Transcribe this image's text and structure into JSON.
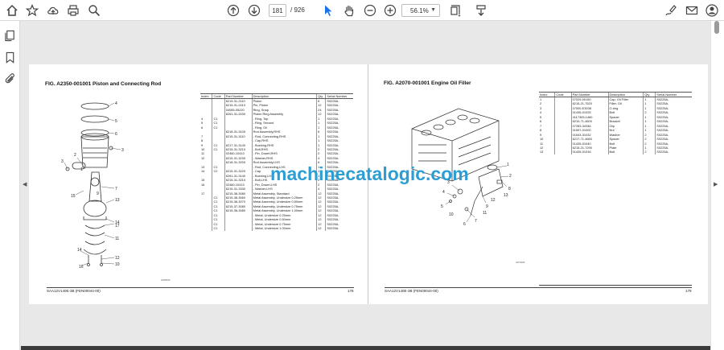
{
  "toolbar": {
    "current_page": "181",
    "total_pages": "/ 926",
    "zoom": "56.1%"
  },
  "left_page": {
    "figure_title": "FIG. A2350-001001    Piston and Connecting Rod",
    "columns": [
      "Index",
      "Code",
      "Part Number",
      "Description",
      "Qty",
      "Serial Number"
    ],
    "rows": [
      [
        "",
        "",
        "6219-31-2110",
        "Piston",
        "6",
        "S0225A-"
      ],
      [
        "",
        "",
        "6215-31-2410",
        "Pin, Piston",
        "12",
        "S0225A-"
      ],
      [
        "",
        "",
        "04065-05220",
        "Ring, Snap",
        "24",
        "S0225A-"
      ],
      [
        "",
        "",
        "6261-31-2030",
        "Piston Ring Assembly",
        "12",
        "S0225A-"
      ],
      [
        "4",
        "C1",
        "",
        "- Ring, Top",
        "1",
        "S0225A-"
      ],
      [
        "5",
        "C1",
        "",
        "- Ring, Second",
        "1",
        "S0225A-"
      ],
      [
        "6",
        "C1",
        "",
        "- Ring, Oil",
        "1",
        "S0225A-"
      ],
      [
        "",
        "",
        "6218-31-3100",
        "Rod Assembly,RHS",
        "6",
        "S0225A-"
      ],
      [
        "7",
        "",
        "6215-31-3110",
        "- Rod, Connecting,RHS",
        "1",
        "S0225A-"
      ],
      [
        "8",
        "",
        "",
        "- Cap,RHS",
        "1",
        "S0225A-"
      ],
      [
        "9",
        "C1",
        "6217-31-3140",
        "- Bushing,RHS",
        "1",
        "S0225A-"
      ],
      [
        "10",
        "C1",
        "6215-31-3210",
        "- Bolt,RHS",
        "2",
        "S0225A-"
      ],
      [
        "11",
        "",
        "02460-10413",
        "- Pin, Dowel,RHS",
        "2",
        "S0225A-"
      ],
      [
        "12",
        "",
        "6215-31-3230",
        "- Washer,RHS",
        "4",
        "S0225A-"
      ],
      [
        "",
        "",
        "6218-31-3200",
        "Rod Assembly,LHS",
        "6",
        "S0225A-"
      ],
      [
        "13",
        "C1",
        "",
        "- Rod, Connecting,LHS",
        "1",
        "S0225A-"
      ],
      [
        "14",
        "C2",
        "6215-31-3220",
        "- Cap",
        "1",
        "S0225A-"
      ],
      [
        "",
        "",
        "6261-31-3140",
        "- Bushing,LHS",
        "1",
        "S0225A-"
      ],
      [
        "15",
        "",
        "6215-31-3210",
        "- Bolt,LHS",
        "2",
        "S0225A-"
      ],
      [
        "16",
        "",
        "02460-10413",
        "- Pin, Dowel,LHS",
        "2",
        "S0225A-"
      ],
      [
        "",
        "",
        "6215-31-3330",
        "- Washer,LHS",
        "4",
        "S0225A-"
      ],
      [
        "17",
        "",
        "6215-36-3080",
        "Metal Assembly, Standard",
        "12",
        "S0225A-"
      ],
      [
        "",
        "C1",
        "6215-36-3060",
        "Metal Assembly, Undersize 0.25mm",
        "12",
        "S0225A-"
      ],
      [
        "",
        "C1",
        "6215-36-3070",
        "Metal Assembly, Undersize 0.50mm",
        "12",
        "S0225A-"
      ],
      [
        "",
        "C1",
        "6215-37-3080",
        "Metal Assembly, Undersize 0.75mm",
        "12",
        "S0225A-"
      ],
      [
        "",
        "C1",
        "6215-36-3080",
        "Metal Assembly, Undersize 1.00mm",
        "12",
        "S0225A-"
      ],
      [
        "",
        "C1",
        "",
        "- Metal, Undersize 0.25mm",
        "12",
        "S0225A-"
      ],
      [
        "",
        "C1",
        "",
        "- Metal, Undersize 0.50mm",
        "12",
        "S0225A-"
      ],
      [
        "",
        "C1",
        "",
        "- Metal, Undersize 0.75mm",
        "12",
        "S0225A-"
      ],
      [
        "",
        "C1",
        "",
        "- Metal, Undersize 1.00mm",
        "12",
        "S0225A-"
      ]
    ],
    "callouts": [
      "4",
      "5",
      "6",
      "3",
      "2",
      "3",
      "1",
      "7",
      "15",
      "13",
      "9",
      "14",
      "17",
      "11",
      "14",
      "12",
      "16",
      "10"
    ],
    "footer_code": "SAA12V140E-3B (FEN00044-00)",
    "page_number": "178",
    "drawing_ref": "A2350K01"
  },
  "right_page": {
    "figure_title": "FIG. A2070-001001    Engine Oil Filler",
    "columns": [
      "Index",
      "Code",
      "Part Number",
      "Description",
      "Qty",
      "Serial Number"
    ],
    "rows": [
      [
        "1",
        "",
        "07029-00150",
        "Cap, Oil Filler",
        "1",
        "S0225A-"
      ],
      [
        "2",
        "",
        "6215-21-7520",
        "Filler, Oil",
        "1",
        "S0225A-"
      ],
      [
        "3",
        "",
        "07000-E3038",
        "O-ring",
        "1",
        "S0225A-"
      ],
      [
        "4",
        "",
        "01435-01025",
        "Bolt",
        "2",
        "S0225A-"
      ],
      [
        "5",
        "",
        "4117305-1460",
        "Spacer",
        "1",
        "S0225A-"
      ],
      [
        "6",
        "",
        "6210-71-4600",
        "Bracket",
        "1",
        "S0225A-"
      ],
      [
        "7",
        "",
        "07283-34346",
        "Clip",
        "1",
        "S0225A-"
      ],
      [
        "8",
        "",
        "01597-01000",
        "Nut",
        "1",
        "S0225A-"
      ],
      [
        "9",
        "",
        "01643-31032",
        "Washer",
        "2",
        "S0225A-"
      ],
      [
        "10",
        "",
        "6217-71-4660",
        "Spacer",
        "2",
        "S0225A-"
      ],
      [
        "11",
        "",
        "01435-01040",
        "Bolt",
        "2",
        "S0225A-"
      ],
      [
        "12",
        "",
        "6215-21-7290",
        "Plate",
        "1",
        "S0225A-"
      ],
      [
        "13",
        "",
        "01435-01016",
        "Bolt",
        "2",
        "S0225A-"
      ]
    ],
    "callouts": [
      "1",
      "2",
      "3",
      "4",
      "5",
      "6",
      "7",
      "8",
      "9",
      "10",
      "11",
      "12",
      "13"
    ],
    "footer_code": "SAA12V140E-3B (FEN00044-00)",
    "page_number": "179",
    "drawing_ref": "A2070K01"
  },
  "watermark": "machinecatalogic.com",
  "colors": {
    "watermark": "#2d9ed3",
    "toolbar_bg": "#ffffff",
    "viewer_bg": "#e8e8e8",
    "select_tool": "#1a73e8"
  },
  "icons": {
    "toolbar": [
      "home-icon",
      "bookmark-star-icon",
      "cloud-upload-icon",
      "print-icon",
      "zoom-search-icon",
      "previous-page-icon",
      "next-page-icon",
      "select-cursor-icon",
      "hand-tool-icon",
      "zoom-out-icon",
      "zoom-in-icon",
      "fit-page-icon",
      "scroll-mode-icon",
      "sign-icon",
      "email-icon",
      "account-icon"
    ],
    "sidebar": [
      "pages-icon",
      "bookmarks-icon",
      "attachments-icon"
    ]
  }
}
